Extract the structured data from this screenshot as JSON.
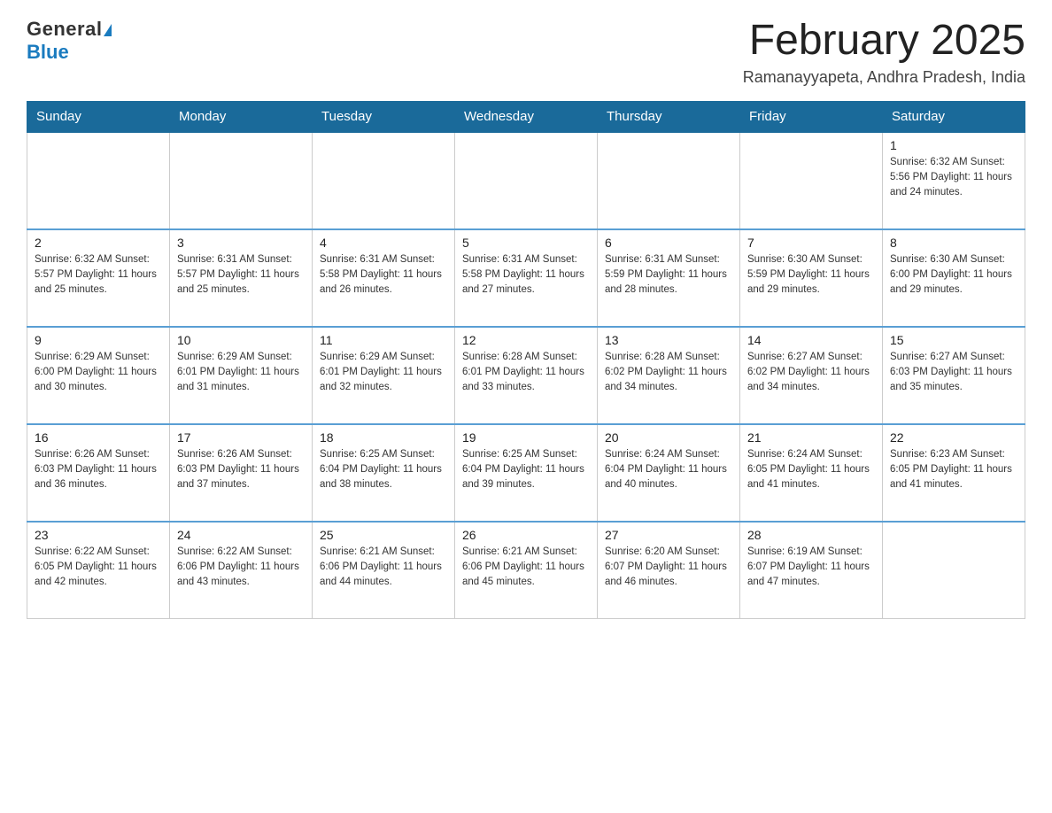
{
  "header": {
    "logo_general": "General",
    "logo_blue": "Blue",
    "month_title": "February 2025",
    "location": "Ramanayyapeta, Andhra Pradesh, India"
  },
  "days_of_week": [
    "Sunday",
    "Monday",
    "Tuesday",
    "Wednesday",
    "Thursday",
    "Friday",
    "Saturday"
  ],
  "weeks": [
    [
      {
        "day": "",
        "info": ""
      },
      {
        "day": "",
        "info": ""
      },
      {
        "day": "",
        "info": ""
      },
      {
        "day": "",
        "info": ""
      },
      {
        "day": "",
        "info": ""
      },
      {
        "day": "",
        "info": ""
      },
      {
        "day": "1",
        "info": "Sunrise: 6:32 AM\nSunset: 5:56 PM\nDaylight: 11 hours and 24 minutes."
      }
    ],
    [
      {
        "day": "2",
        "info": "Sunrise: 6:32 AM\nSunset: 5:57 PM\nDaylight: 11 hours and 25 minutes."
      },
      {
        "day": "3",
        "info": "Sunrise: 6:31 AM\nSunset: 5:57 PM\nDaylight: 11 hours and 25 minutes."
      },
      {
        "day": "4",
        "info": "Sunrise: 6:31 AM\nSunset: 5:58 PM\nDaylight: 11 hours and 26 minutes."
      },
      {
        "day": "5",
        "info": "Sunrise: 6:31 AM\nSunset: 5:58 PM\nDaylight: 11 hours and 27 minutes."
      },
      {
        "day": "6",
        "info": "Sunrise: 6:31 AM\nSunset: 5:59 PM\nDaylight: 11 hours and 28 minutes."
      },
      {
        "day": "7",
        "info": "Sunrise: 6:30 AM\nSunset: 5:59 PM\nDaylight: 11 hours and 29 minutes."
      },
      {
        "day": "8",
        "info": "Sunrise: 6:30 AM\nSunset: 6:00 PM\nDaylight: 11 hours and 29 minutes."
      }
    ],
    [
      {
        "day": "9",
        "info": "Sunrise: 6:29 AM\nSunset: 6:00 PM\nDaylight: 11 hours and 30 minutes."
      },
      {
        "day": "10",
        "info": "Sunrise: 6:29 AM\nSunset: 6:01 PM\nDaylight: 11 hours and 31 minutes."
      },
      {
        "day": "11",
        "info": "Sunrise: 6:29 AM\nSunset: 6:01 PM\nDaylight: 11 hours and 32 minutes."
      },
      {
        "day": "12",
        "info": "Sunrise: 6:28 AM\nSunset: 6:01 PM\nDaylight: 11 hours and 33 minutes."
      },
      {
        "day": "13",
        "info": "Sunrise: 6:28 AM\nSunset: 6:02 PM\nDaylight: 11 hours and 34 minutes."
      },
      {
        "day": "14",
        "info": "Sunrise: 6:27 AM\nSunset: 6:02 PM\nDaylight: 11 hours and 34 minutes."
      },
      {
        "day": "15",
        "info": "Sunrise: 6:27 AM\nSunset: 6:03 PM\nDaylight: 11 hours and 35 minutes."
      }
    ],
    [
      {
        "day": "16",
        "info": "Sunrise: 6:26 AM\nSunset: 6:03 PM\nDaylight: 11 hours and 36 minutes."
      },
      {
        "day": "17",
        "info": "Sunrise: 6:26 AM\nSunset: 6:03 PM\nDaylight: 11 hours and 37 minutes."
      },
      {
        "day": "18",
        "info": "Sunrise: 6:25 AM\nSunset: 6:04 PM\nDaylight: 11 hours and 38 minutes."
      },
      {
        "day": "19",
        "info": "Sunrise: 6:25 AM\nSunset: 6:04 PM\nDaylight: 11 hours and 39 minutes."
      },
      {
        "day": "20",
        "info": "Sunrise: 6:24 AM\nSunset: 6:04 PM\nDaylight: 11 hours and 40 minutes."
      },
      {
        "day": "21",
        "info": "Sunrise: 6:24 AM\nSunset: 6:05 PM\nDaylight: 11 hours and 41 minutes."
      },
      {
        "day": "22",
        "info": "Sunrise: 6:23 AM\nSunset: 6:05 PM\nDaylight: 11 hours and 41 minutes."
      }
    ],
    [
      {
        "day": "23",
        "info": "Sunrise: 6:22 AM\nSunset: 6:05 PM\nDaylight: 11 hours and 42 minutes."
      },
      {
        "day": "24",
        "info": "Sunrise: 6:22 AM\nSunset: 6:06 PM\nDaylight: 11 hours and 43 minutes."
      },
      {
        "day": "25",
        "info": "Sunrise: 6:21 AM\nSunset: 6:06 PM\nDaylight: 11 hours and 44 minutes."
      },
      {
        "day": "26",
        "info": "Sunrise: 6:21 AM\nSunset: 6:06 PM\nDaylight: 11 hours and 45 minutes."
      },
      {
        "day": "27",
        "info": "Sunrise: 6:20 AM\nSunset: 6:07 PM\nDaylight: 11 hours and 46 minutes."
      },
      {
        "day": "28",
        "info": "Sunrise: 6:19 AM\nSunset: 6:07 PM\nDaylight: 11 hours and 47 minutes."
      },
      {
        "day": "",
        "info": ""
      }
    ]
  ]
}
